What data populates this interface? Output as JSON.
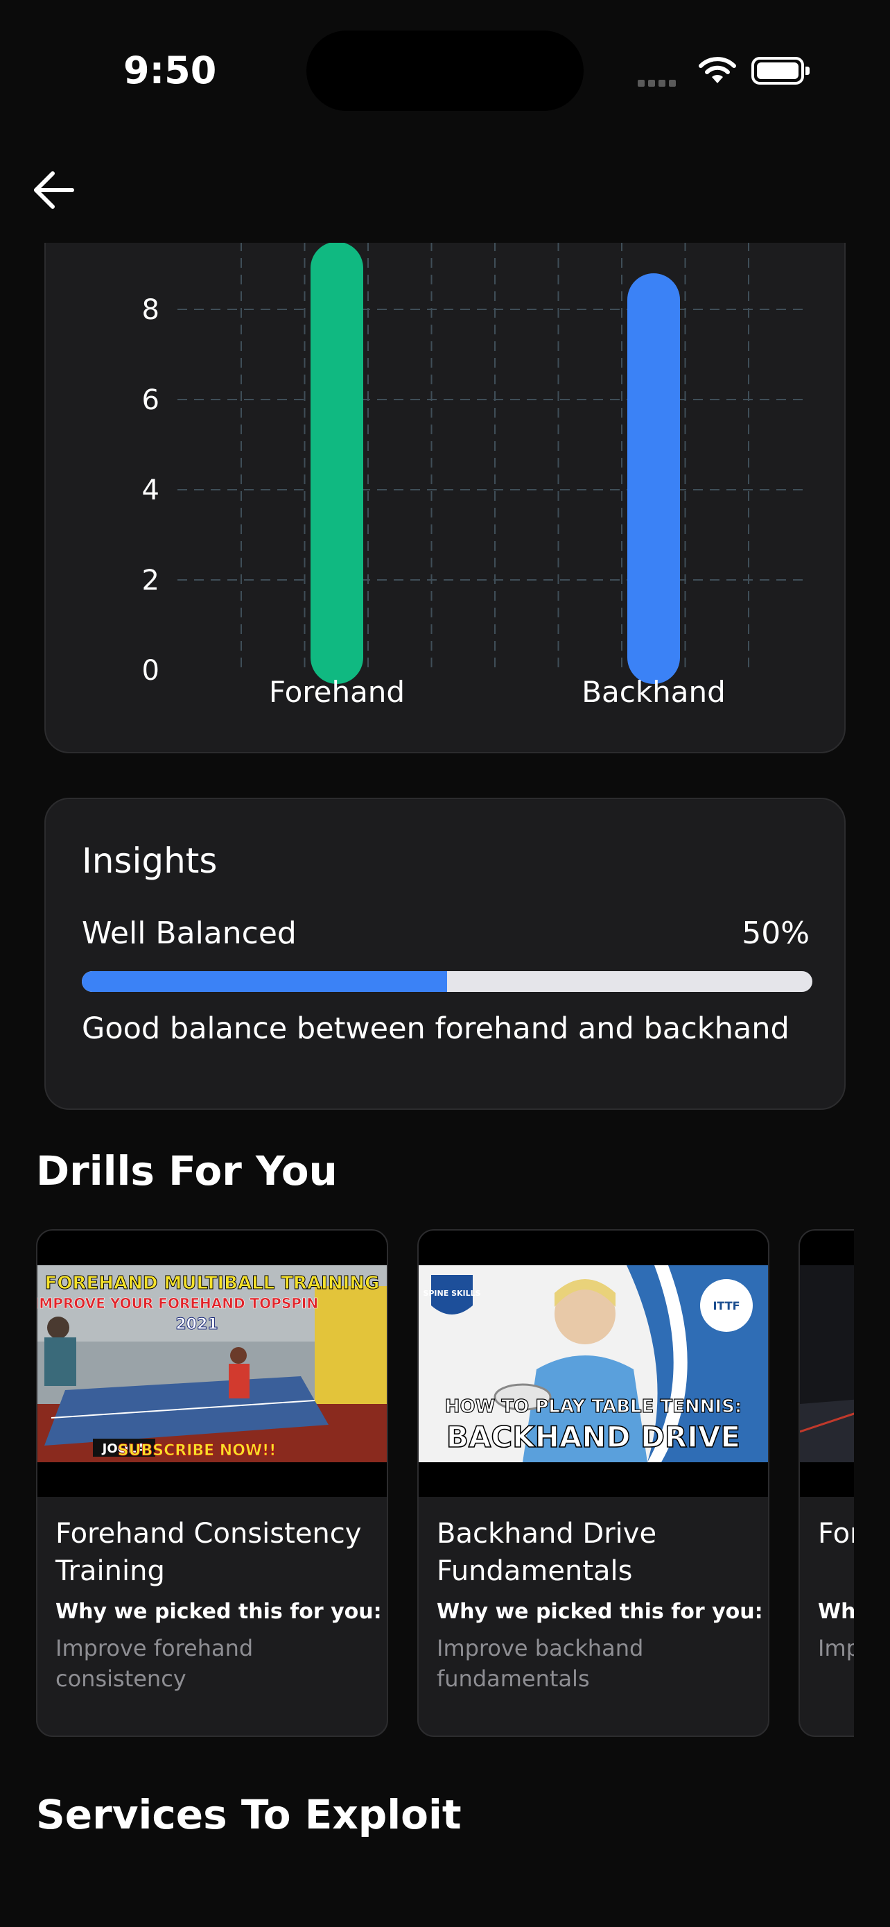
{
  "status_bar": {
    "time": "9:50"
  },
  "nav": {
    "back_icon": "arrow-left-icon"
  },
  "chart_data": {
    "type": "bar",
    "categories": [
      "Forehand",
      "Backhand"
    ],
    "values": [
      9.5,
      8.8
    ],
    "colors": [
      "#10b981",
      "#3b82f6"
    ],
    "y_ticks": [
      "0",
      "2",
      "4",
      "6",
      "8"
    ],
    "ylim": [
      0,
      10
    ],
    "grid": true
  },
  "insights": {
    "title": "Insights",
    "status": "Well Balanced",
    "percent_label": "50%",
    "progress": 0.5,
    "description": "Good balance between forehand and backhand"
  },
  "drills": {
    "section_title": "Drills For You",
    "items": [
      {
        "title": "Forehand Consistency Training",
        "why_label": "Why we picked this for you:",
        "reason": "Improve forehand consistency",
        "thumb": {
          "line1": "FOREHAND MULTIBALL TRAINING",
          "line2": "IMPROVE YOUR FOREHAND TOPSPIN",
          "line3": "2021",
          "line4": "SUBSCRIBE NOW!!",
          "brand": "JOOLA"
        }
      },
      {
        "title": "Backhand Drive Fundamentals",
        "why_label": "Why we picked this for you:",
        "reason": "Improve backhand fundamentals",
        "thumb": {
          "badge": "SPINE SKILLS",
          "line1": "HOW TO PLAY TABLE TENNIS:",
          "line2": "BACKHAND DRIVE",
          "logo": "ITTF"
        }
      },
      {
        "title": "Forehand Training",
        "why_label": "Why we picked this for you:",
        "reason": "Improve"
      }
    ]
  },
  "services": {
    "section_title": "Services To Exploit"
  }
}
